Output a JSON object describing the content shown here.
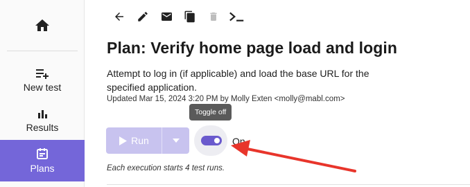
{
  "sidebar": {
    "home_icon": "home-icon",
    "items": [
      {
        "label": "New test",
        "icon": "playlist-add-icon",
        "active": false
      },
      {
        "label": "Results",
        "icon": "bar-chart-icon",
        "active": false
      },
      {
        "label": "Plans",
        "icon": "calendar-icon",
        "active": true
      }
    ]
  },
  "toolbar": {
    "icons": [
      "arrow-left-icon",
      "pencil-icon",
      "envelope-icon",
      "copy-icon",
      "trash-icon",
      "terminal-icon"
    ],
    "disabled": [
      "trash-icon"
    ]
  },
  "plan": {
    "title": "Plan: Verify home page load and login",
    "description": "Attempt to log in (if applicable) and load the base URL for the specified application.",
    "updated": "Updated Mar 15, 2024 3:20 PM by Molly Exten <molly@mabl.com>"
  },
  "tooltip": {
    "text": "Toggle off"
  },
  "run": {
    "label": "Run",
    "state": "disabled"
  },
  "toggle": {
    "state_label": "On",
    "on": true
  },
  "execution_note": "Each execution starts 4 test runs.",
  "colors": {
    "accent": "#6a5acd",
    "active_nav": "#7466d9",
    "disabled_button": "#c8c3ef",
    "annotation_arrow": "#e8352b"
  }
}
